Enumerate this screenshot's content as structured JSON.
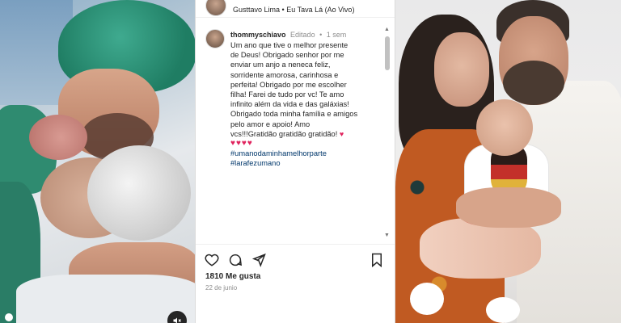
{
  "post": {
    "header": {
      "account": "Gusttavo Lima",
      "separator": "•",
      "audio": "Eu Tava Lá (Ao Vivo)"
    },
    "caption": {
      "username": "thommyschiavo",
      "edited": "Editado",
      "dot": "•",
      "age": "1 sem",
      "lines": [
        "Um ano que tive o melhor presente",
        "de Deus! Obrigado senhor por me",
        "enviar um anjo a neneca feliz,",
        "sorridente amorosa, carinhosa e",
        "perfeita! Obrigado por me escolher",
        "filha! Farei de tudo por vc! Te amo",
        "infinito além da vida e das galáxias!",
        "Obrigado toda minha família e amigos",
        "pelo amor e apoio! Amo",
        "vcs!!!Gratidão gratidão gratidão!"
      ],
      "inline_heart": "♥",
      "hearts": "♥♥♥♥",
      "hashtags": [
        "#umanodaminhamelhorparte",
        "#larafezumano"
      ]
    },
    "likes": "1810 Me gusta",
    "date": "22 de junio"
  },
  "icons": {
    "like": "heart-icon",
    "comment": "comment-icon",
    "share": "send-icon",
    "save": "bookmark-icon",
    "mute": "speaker-muted-icon"
  },
  "colors": {
    "text": "#262626",
    "muted": "#8e8e8e",
    "hashtag": "#00376b",
    "heart": "#e0245e"
  }
}
